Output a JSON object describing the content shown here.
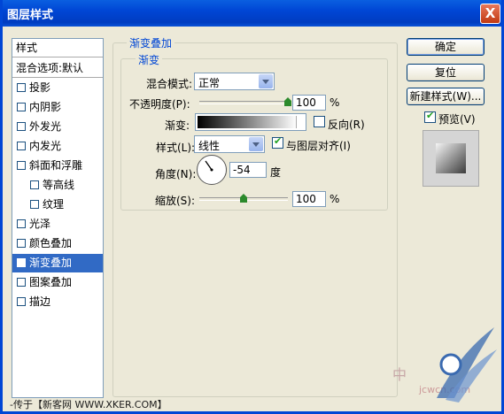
{
  "window": {
    "title": "图层样式",
    "close_symbol": "X"
  },
  "style_list": {
    "header": "样式",
    "blend_options": "混合选项:默认",
    "items": [
      {
        "label": "投影",
        "checked": false,
        "indent": false
      },
      {
        "label": "内阴影",
        "checked": false,
        "indent": false
      },
      {
        "label": "外发光",
        "checked": false,
        "indent": false
      },
      {
        "label": "内发光",
        "checked": false,
        "indent": false
      },
      {
        "label": "斜面和浮雕",
        "checked": false,
        "indent": false
      },
      {
        "label": "等高线",
        "checked": false,
        "indent": true
      },
      {
        "label": "纹理",
        "checked": false,
        "indent": true
      },
      {
        "label": "光泽",
        "checked": false,
        "indent": false
      },
      {
        "label": "颜色叠加",
        "checked": false,
        "indent": false
      },
      {
        "label": "渐变叠加",
        "checked": true,
        "indent": false,
        "selected": true
      },
      {
        "label": "图案叠加",
        "checked": false,
        "indent": false
      },
      {
        "label": "描边",
        "checked": false,
        "indent": false
      }
    ]
  },
  "panel": {
    "section_title": "渐变叠加",
    "group_title": "渐变",
    "blend_mode_label": "混合模式:",
    "blend_mode_value": "正常",
    "opacity_label": "不透明度(P):",
    "opacity_value": "100",
    "opacity_unit": "%",
    "opacity_level": 1.0,
    "gradient_label": "渐变:",
    "reverse_label": "反向(R)",
    "reverse_checked": false,
    "style_label": "样式(L):",
    "style_value": "线性",
    "align_label": "与图层对齐(I)",
    "align_checked": true,
    "angle_label": "角度(N):",
    "angle_value": "-54",
    "angle_unit": "度",
    "scale_label": "缩放(S):",
    "scale_value": "100",
    "scale_unit": "%",
    "scale_level": 0.5
  },
  "buttons": {
    "ok": "确定",
    "reset": "复位",
    "new_style": "新建样式(W)...",
    "preview_label": "预览(V)",
    "preview_checked": true
  },
  "watermark": {
    "bottom_text": "-传于【新客网 WWW.XKER.COM】",
    "zhong": "中",
    "site": "jcwcn.com"
  },
  "colors": {
    "accent": "#0046d5",
    "selection": "#316ac5",
    "dialog_bg": "#ece9d8"
  }
}
